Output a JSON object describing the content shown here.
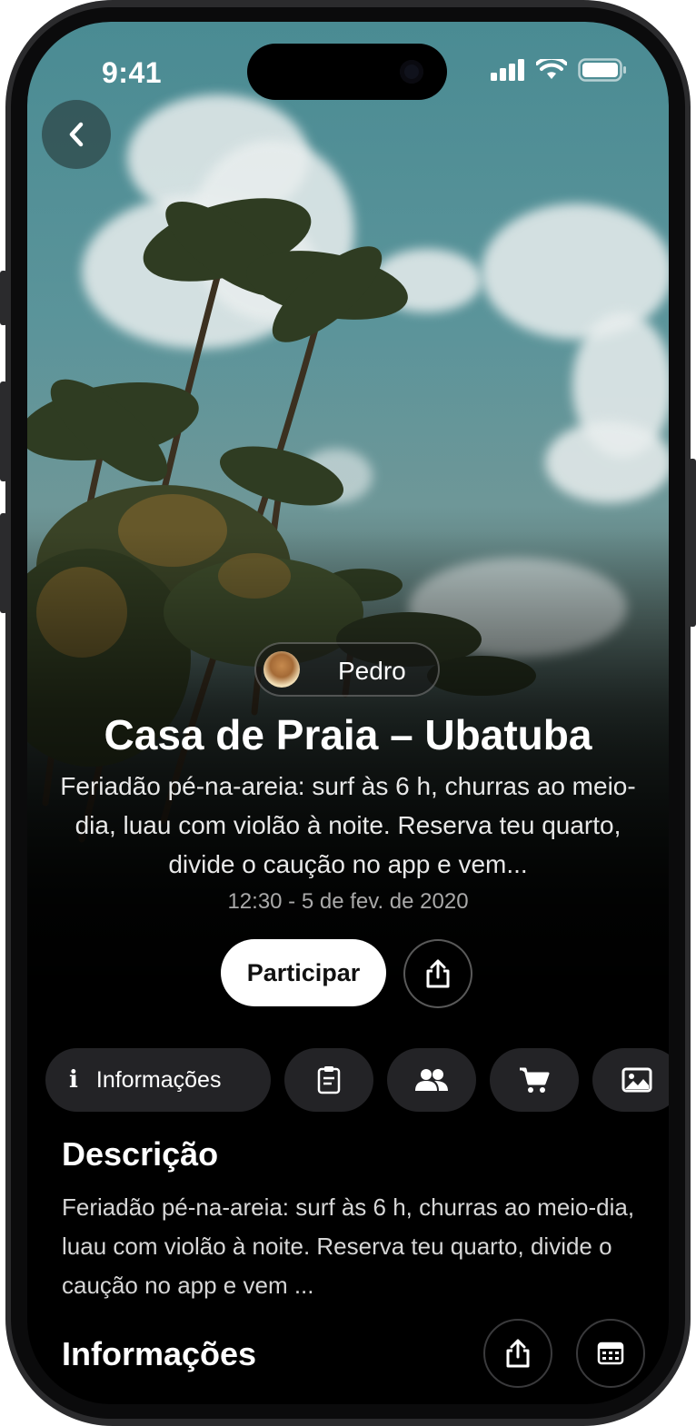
{
  "status_bar": {
    "time": "9:41"
  },
  "event": {
    "host_name": "Pedro",
    "title": "Casa de Praia – Ubatuba",
    "subtitle": "Feriadão pé-na-areia: surf às 6 h, churras ao meio-dia, luau com violão à noite. Reserva teu quarto, divide o caução no app e vem...",
    "datetime": "12:30 - 5 de fev. de 2020",
    "join_label": "Participar"
  },
  "tabs": {
    "info_icon": "i",
    "info_label": "Informações",
    "icons": [
      "clipboard-icon",
      "people-icon",
      "cart-icon",
      "image-icon"
    ]
  },
  "description": {
    "heading": "Descrição",
    "text": "Feriadão pé-na-areia: surf às 6 h, churras ao meio-dia, luau com violão à noite. Reserva teu quarto, divide o caução no app e vem ..."
  },
  "info_section": {
    "heading": "Informações"
  },
  "colors": {
    "background": "#000000",
    "tab_bg": "#232326",
    "accent": "#ffffff"
  }
}
